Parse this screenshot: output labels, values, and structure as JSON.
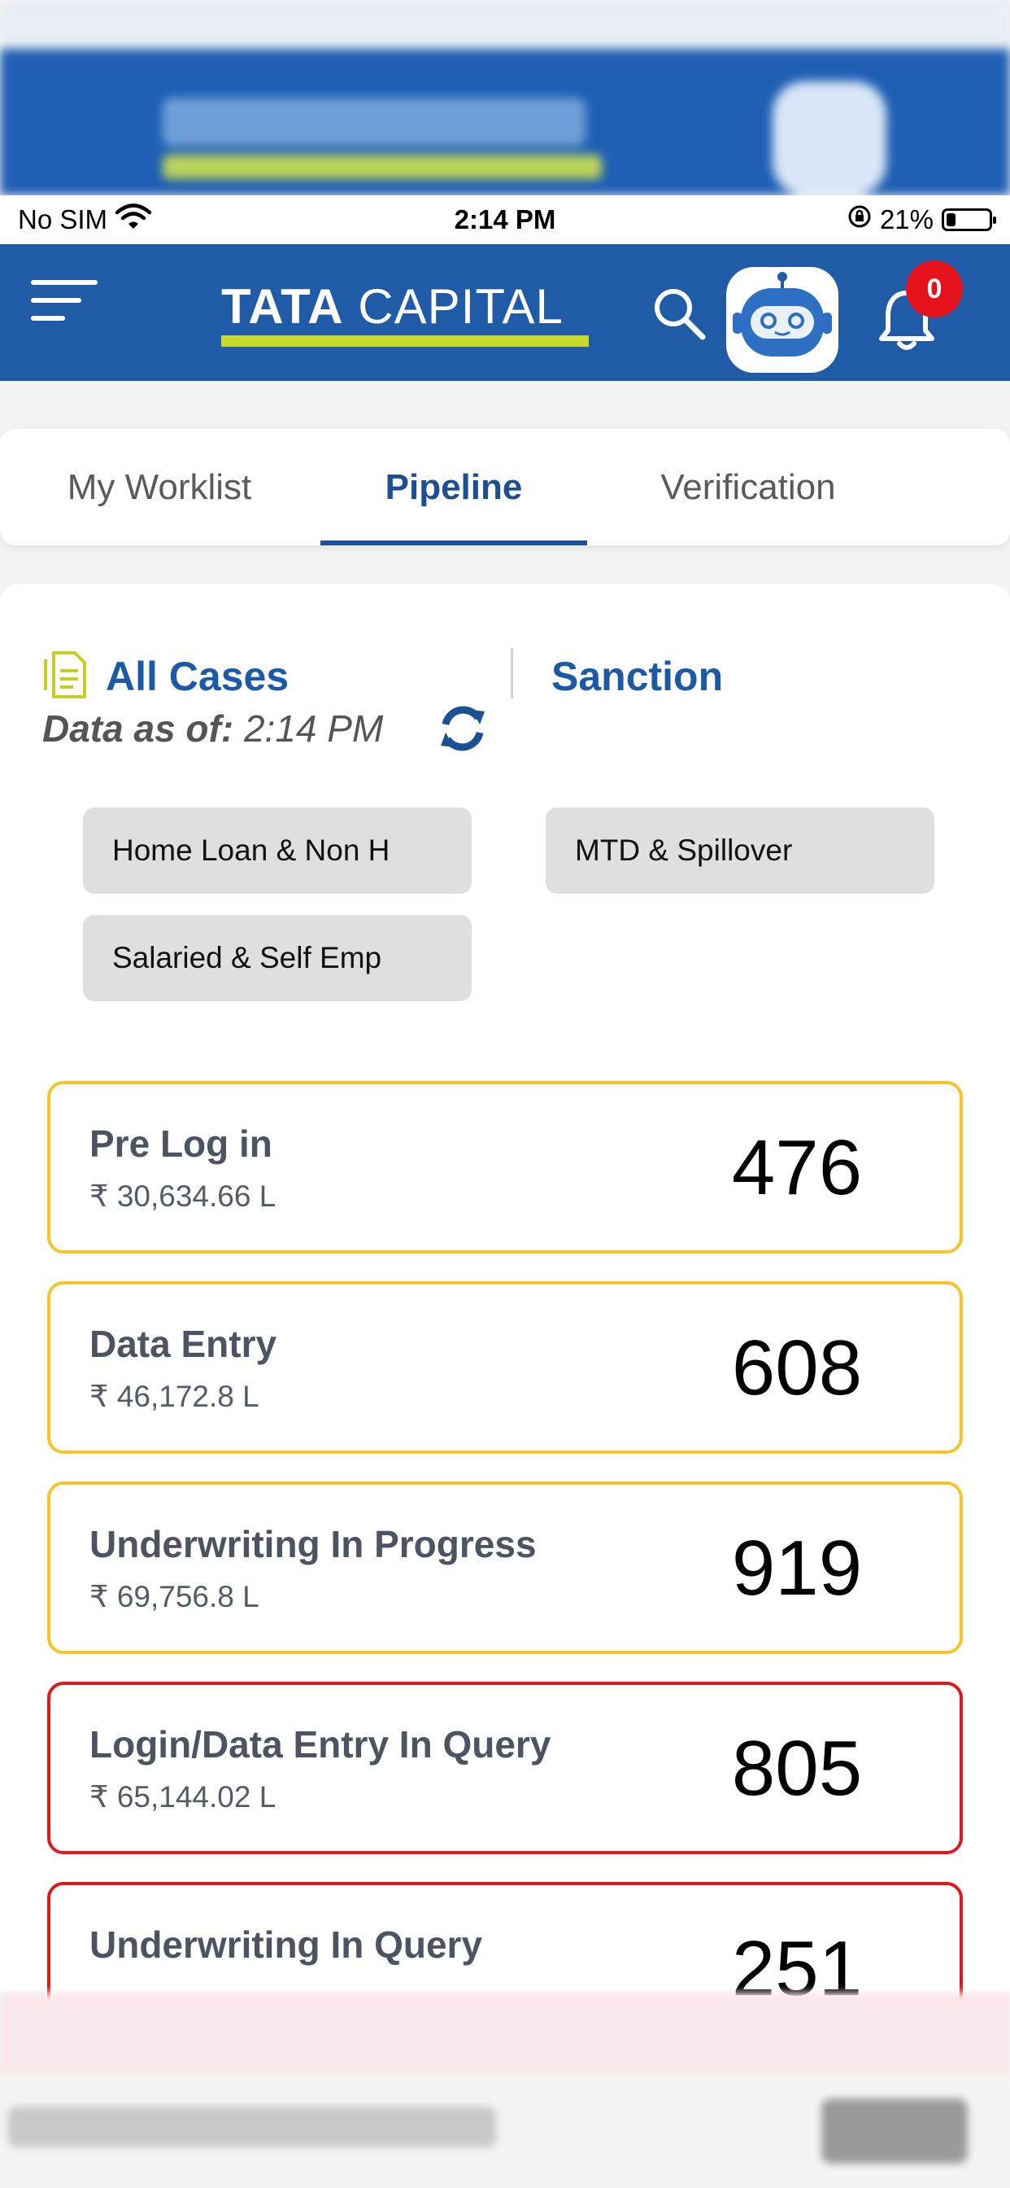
{
  "status_bar": {
    "carrier": "No SIM",
    "time": "2:14 PM",
    "battery": "21%",
    "battery_level": 0.21
  },
  "header": {
    "logo_bold": "TATA",
    "logo_rest": "CAPITAL",
    "notification_count": "0",
    "brand_blue": "#1f5ba6",
    "brand_lime": "#c8da2b"
  },
  "tabs": [
    {
      "label": "My Worklist",
      "active": false
    },
    {
      "label": "Pipeline",
      "active": true
    },
    {
      "label": "Verification",
      "active": false
    }
  ],
  "pipeline": {
    "all_cases_label": "All Cases",
    "sanction_label": "Sanction",
    "data_as_of_label": "Data as of:",
    "data_as_of_time": "2:14 PM",
    "filters": [
      "Home Loan & Non H",
      "MTD & Spillover",
      "Salaried & Self Emp"
    ]
  },
  "cards": [
    {
      "title": "Pre Log in",
      "amount": "₹ 30,634.66 L",
      "count": "476",
      "status_color": "#f6c42b"
    },
    {
      "title": "Data Entry",
      "amount": "₹ 46,172.8 L",
      "count": "608",
      "status_color": "#f6c42b"
    },
    {
      "title": "Underwriting In Progress",
      "amount": "₹ 69,756.8 L",
      "count": "919",
      "status_color": "#f6c42b"
    },
    {
      "title": "Login/Data Entry In Query",
      "amount": "₹ 65,144.02 L",
      "count": "805",
      "status_color": "#e0171c"
    },
    {
      "title": "Underwriting In Query",
      "amount": "",
      "count": "251",
      "status_color": "#e0171c"
    }
  ]
}
